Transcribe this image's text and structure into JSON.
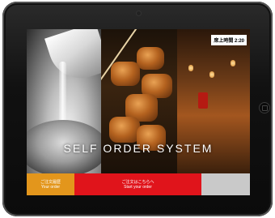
{
  "screen": {
    "headline": "SELF ORDER SYSTEM",
    "timer_badge": "席上時間 2:20"
  },
  "bottom_bar": {
    "orange_button": {
      "label_jp": "ご注文履歴",
      "label_en": "Your order"
    },
    "red_button": {
      "label_jp": "ご注文はこちらへ",
      "label_en": "Start your order"
    },
    "gray_button": {
      "label_jp": "",
      "label_en": ""
    }
  },
  "colors": {
    "orange": "#e3961c",
    "red": "#e0141b",
    "gray": "#c9c9c9"
  }
}
